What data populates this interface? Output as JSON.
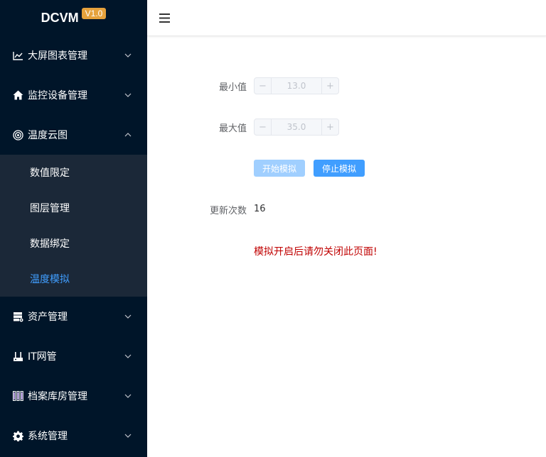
{
  "app": {
    "logo": "DCVM",
    "version": "V1.0"
  },
  "sidebar": {
    "items": [
      {
        "label": "大屏图表管理",
        "icon": "line-chart-icon",
        "expanded": false
      },
      {
        "label": "监控设备管理",
        "icon": "home-icon",
        "expanded": false
      },
      {
        "label": "温度云图",
        "icon": "target-icon",
        "expanded": true,
        "children": [
          {
            "label": "数值限定"
          },
          {
            "label": "图层管理"
          },
          {
            "label": "数据绑定"
          },
          {
            "label": "温度模拟",
            "active": true
          }
        ]
      },
      {
        "label": "资产管理",
        "icon": "server-icon",
        "expanded": false
      },
      {
        "label": "IT网管",
        "icon": "router-icon",
        "expanded": false
      },
      {
        "label": "档案库房管理",
        "icon": "archive-icon",
        "expanded": false
      },
      {
        "label": "系统管理",
        "icon": "gear-icon",
        "expanded": false
      }
    ]
  },
  "header": {
    "menu_icon": "hamburger-icon"
  },
  "form": {
    "min": {
      "label": "最小值",
      "value": "13.0"
    },
    "max": {
      "label": "最大值",
      "value": "35.0"
    },
    "start_button": "开始模拟",
    "stop_button": "停止模拟",
    "update_count": {
      "label": "更新次数",
      "value": "16"
    },
    "warning": "模拟开启后请勿关闭此页面!"
  },
  "colors": {
    "sidebar_bg": "#001529",
    "submenu_bg": "#1b2838",
    "accent": "#409eff",
    "accent_disabled": "#a0cfff",
    "badge": "#e6a23c",
    "warning": "#c00000"
  }
}
